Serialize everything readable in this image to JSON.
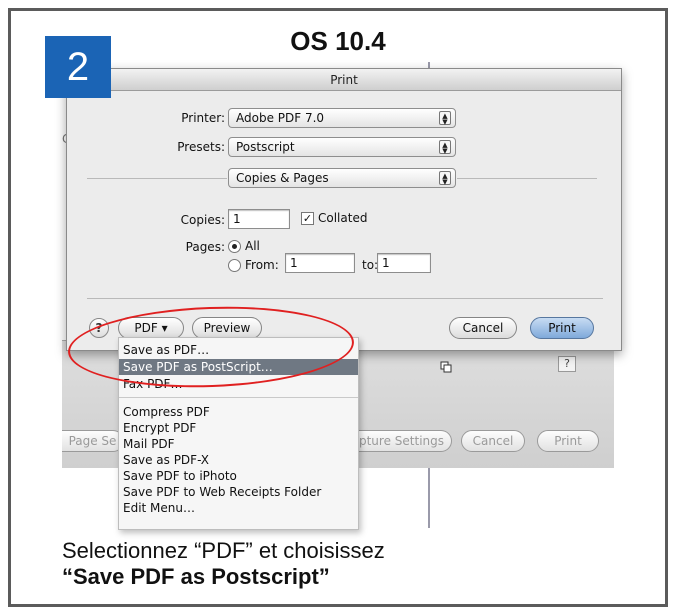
{
  "heading": "OS 10.4",
  "step_number": "2",
  "dialog": {
    "title": "Print",
    "printer_label": "Printer:",
    "printer_value": "Adobe PDF 7.0",
    "presets_label": "Presets:",
    "presets_value": "Postscript",
    "panel_value": "Copies & Pages",
    "copies_label": "Copies:",
    "copies_value": "1",
    "collated_label": "Collated",
    "pages_label": "Pages:",
    "all_label": "All",
    "from_label": "From:",
    "from_value": "1",
    "to_label": "to:",
    "to_value": "1",
    "pdf_button": "PDF ▾",
    "preview_button": "Preview",
    "cancel_button": "Cancel",
    "print_button": "Print",
    "help_symbol": "?"
  },
  "pdf_menu": {
    "items": [
      "Save as PDF…",
      "Save PDF as PostScript…",
      "Fax PDF…",
      "Compress PDF",
      "Encrypt PDF",
      "Mail PDF",
      "Save as PDF-X",
      "Save PDF to iPhoto",
      "Save PDF to Web Receipts Folder",
      "Edit Menu…"
    ],
    "selected_index": 1
  },
  "background_window": {
    "page_setup": "Page Se",
    "capture_settings": "pture Settings",
    "cancel": "Cancel",
    "print": "Print",
    "help_symbol": "?",
    "partial_letter": "C"
  },
  "caption": {
    "line1": "Selectionnez “PDF” et choisissez",
    "line2": "“Save PDF as Postscript”"
  },
  "colors": {
    "badge": "#1b64b5",
    "highlight_ring": "#e02020",
    "menu_selection": "#6f7883",
    "default_button": "#7fa9da"
  }
}
